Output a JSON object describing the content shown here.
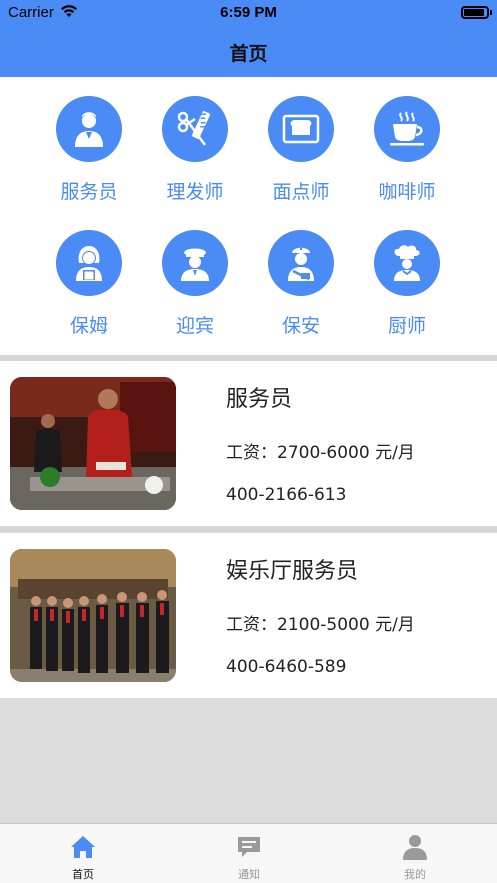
{
  "status_bar": {
    "carrier": "Carrier",
    "time": "6:59 PM"
  },
  "nav": {
    "title": "首页"
  },
  "categories": [
    {
      "label": "服务员",
      "icon": "waiter-icon"
    },
    {
      "label": "理发师",
      "icon": "comb-scissors-icon"
    },
    {
      "label": "面点师",
      "icon": "bread-icon"
    },
    {
      "label": "咖啡师",
      "icon": "coffee-cup-icon"
    },
    {
      "label": "保姆",
      "icon": "nanny-icon"
    },
    {
      "label": "迎宾",
      "icon": "greeter-icon"
    },
    {
      "label": "保安",
      "icon": "security-guard-icon"
    },
    {
      "label": "厨师",
      "icon": "chef-icon"
    }
  ],
  "jobs": [
    {
      "title": "服务员",
      "salary": "工资：2700-6000 元/月",
      "phone": "400-2166-613"
    },
    {
      "title": "娱乐厅服务员",
      "salary": "工资：2100-5000 元/月",
      "phone": "400-6460-589"
    }
  ],
  "tabs": [
    {
      "label": "首页",
      "icon": "home-icon",
      "active": true
    },
    {
      "label": "通知",
      "icon": "message-icon",
      "active": false
    },
    {
      "label": "我的",
      "icon": "person-icon",
      "active": false
    }
  ],
  "colors": {
    "accent": "#4a8bf5",
    "background": "#dcdcdc"
  }
}
